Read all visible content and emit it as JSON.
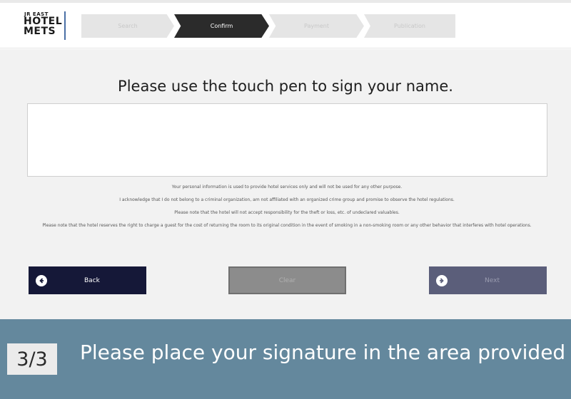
{
  "logo": {
    "sub": "JR EAST",
    "line1": "HOTEL",
    "line2": "METS"
  },
  "steps": [
    {
      "label": "Search"
    },
    {
      "label": "Confirm"
    },
    {
      "label": "Payment"
    },
    {
      "label": "Publication"
    }
  ],
  "main": {
    "instruction": "Please use the touch pen to sign your name.",
    "notices": [
      "Your personal information is used to provide hotel services only and will not be used for any other purpose.",
      "I acknowledge that I do not belong to a criminal organization, am not affiliated with an organized crime group and promise to observe the hotel regulations.",
      "Please note that the hotel will not accept responsibility for the theft or loss, etc. of undeclared valuables.",
      "Please note that the hotel reserves the right to charge a guest for the cost of returning the room to its original condition in the event of smoking in a non-smoking room or any other behavior that interferes with hotel operations."
    ]
  },
  "buttons": {
    "back": "Back",
    "clear": "Clear",
    "next": "Next"
  },
  "banner": {
    "page": "3/3",
    "text": "Please place your signature in the area provided"
  },
  "colors": {
    "active_step": "#2b2b2b",
    "back_button": "#151838",
    "banner": "#64889d"
  }
}
